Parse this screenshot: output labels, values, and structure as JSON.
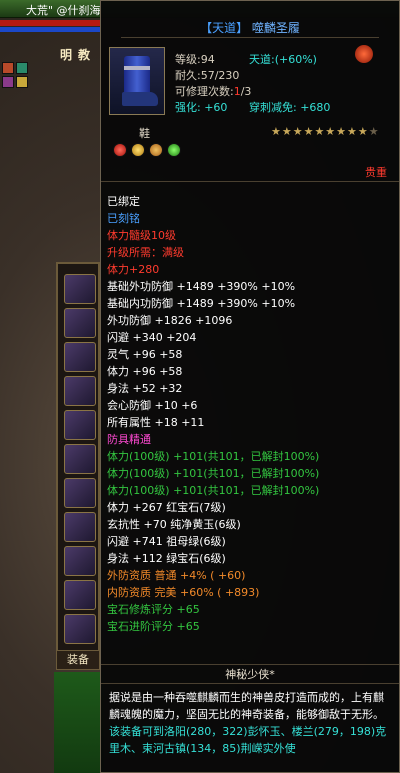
{
  "hud": {
    "top_text": "大荒\" @什刹海",
    "npc_name": "明教",
    "panel_tab": "装备"
  },
  "tooltip": {
    "title_grade": "【天道】",
    "title_name": "噬麟圣履",
    "level_label": "等级:94",
    "tiandao": "天道:(+60%)",
    "durability": "耐久:57/230",
    "repairs_label": "可修理次数:",
    "repairs_value": "1",
    "repairs_max": "/3",
    "enhance": "强化: +60",
    "pierce": "穿刺减免: +680",
    "item_type": "鞋",
    "stars": "★★★★★★★★★",
    "stars_empty": "★",
    "quality": "贵重",
    "lines": [
      {
        "text": "已绑定",
        "color": "white"
      },
      {
        "text": "已刻铭",
        "color": "blue"
      },
      {
        "text": "体力髓级10级",
        "color": "red"
      },
      {
        "text": "升级所需：满级",
        "color": "red"
      },
      {
        "text": "体力+280",
        "color": "red"
      },
      {
        "text": "基础外功防御 +1489 +390% +10%",
        "color": "white"
      },
      {
        "text": "基础内功防御 +1489 +390% +10%",
        "color": "white"
      },
      {
        "text": "外功防御 +1826 +1096",
        "color": "white"
      },
      {
        "text": "闪避 +340 +204",
        "color": "white"
      },
      {
        "text": "灵气 +96 +58",
        "color": "white"
      },
      {
        "text": "体力 +96 +58",
        "color": "white"
      },
      {
        "text": "身法 +52 +32",
        "color": "white"
      },
      {
        "text": "会心防御 +10 +6",
        "color": "white"
      },
      {
        "text": "所有属性 +18 +11",
        "color": "white"
      },
      {
        "text": "防具精通",
        "color": "magenta"
      },
      {
        "text": "体力(100级) +101(共101，已解封100%)",
        "color": "green"
      },
      {
        "text": "体力(100级) +101(共101，已解封100%)",
        "color": "green"
      },
      {
        "text": "体力(100级) +101(共101，已解封100%)",
        "color": "green"
      },
      {
        "text": "体力 +267 红宝石(7级)",
        "color": "white"
      },
      {
        "text": "玄抗性 +70 纯净黄玉(6级)",
        "color": "white"
      },
      {
        "text": "闪避 +741 祖母绿(6级)",
        "color": "white"
      },
      {
        "text": "身法 +112 绿宝石(6级)",
        "color": "white"
      },
      {
        "text": "外防资质  普通 +4% ( +60)",
        "color": "orange"
      },
      {
        "text": "内防资质  完美 +60% ( +893)",
        "color": "orange"
      },
      {
        "text": "宝石修炼评分 +65",
        "color": "green"
      },
      {
        "text": "宝石进阶评分 +65",
        "color": "green"
      }
    ],
    "author": "神秘少侠*",
    "description": "据说是由一种吞噬麒麟而生的神兽皮打造而成的，上有麒麟魂魄的魔力，坚固无比的神奇装备，能够御敌于无形。",
    "location": "该装备可到洛阳(280，322)彭怀玉、楼兰(279，198)克里木、束河古镇(134，85)荆嵘实外使"
  },
  "colors": {
    "white": "#ffffff",
    "blue": "#4aa0ff",
    "red": "#ff3b2e",
    "orange": "#f28a2a",
    "green": "#33c640",
    "magenta": "#ff4ad2",
    "cyan": "#35e0d6"
  }
}
